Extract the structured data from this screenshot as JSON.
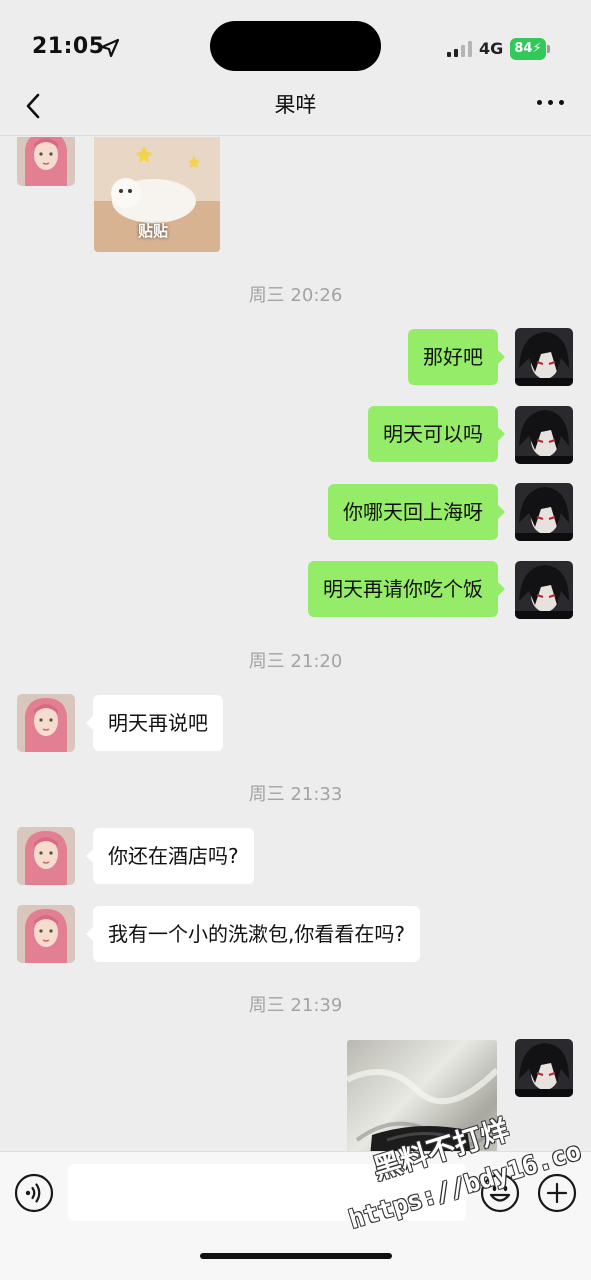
{
  "status_bar": {
    "time": "21:05",
    "network": "4G",
    "battery": "84"
  },
  "nav": {
    "title": "果咩"
  },
  "messages": [
    {
      "type": "time",
      "text": "周三 20:26"
    },
    {
      "type": "text",
      "from": "me",
      "text": "那好吧"
    },
    {
      "type": "text",
      "from": "me",
      "text": "明天可以吗"
    },
    {
      "type": "text",
      "from": "me",
      "text": "你哪天回上海呀"
    },
    {
      "type": "text",
      "from": "me",
      "text": "明天再请你吃个饭"
    },
    {
      "type": "time",
      "text": "周三 21:20"
    },
    {
      "type": "text",
      "from": "contact",
      "text": "明天再说吧"
    },
    {
      "type": "time",
      "text": "周三 21:33"
    },
    {
      "type": "text",
      "from": "contact",
      "text": "你还在酒店吗?"
    },
    {
      "type": "text",
      "from": "contact",
      "text": "我有一个小的洗漱包,你看看在吗?"
    },
    {
      "type": "time",
      "text": "周三 21:39"
    }
  ],
  "sticker": {
    "caption": "贴贴"
  },
  "watermark": {
    "line1": "黑料不打烊",
    "line2": "https://bdy16.co"
  },
  "icons": {
    "back": "chevron-left-icon",
    "more": "more-dots-icon",
    "voice": "voice-icon",
    "emoji": "emoji-icon",
    "plus": "plus-icon",
    "location": "location-arrow-icon",
    "signal": "signal-icon"
  },
  "colors": {
    "background": "#ededed",
    "sent_bubble": "#95ec69",
    "received_bubble": "#ffffff",
    "timestamp": "#a3a3a3",
    "battery": "#34c759"
  }
}
